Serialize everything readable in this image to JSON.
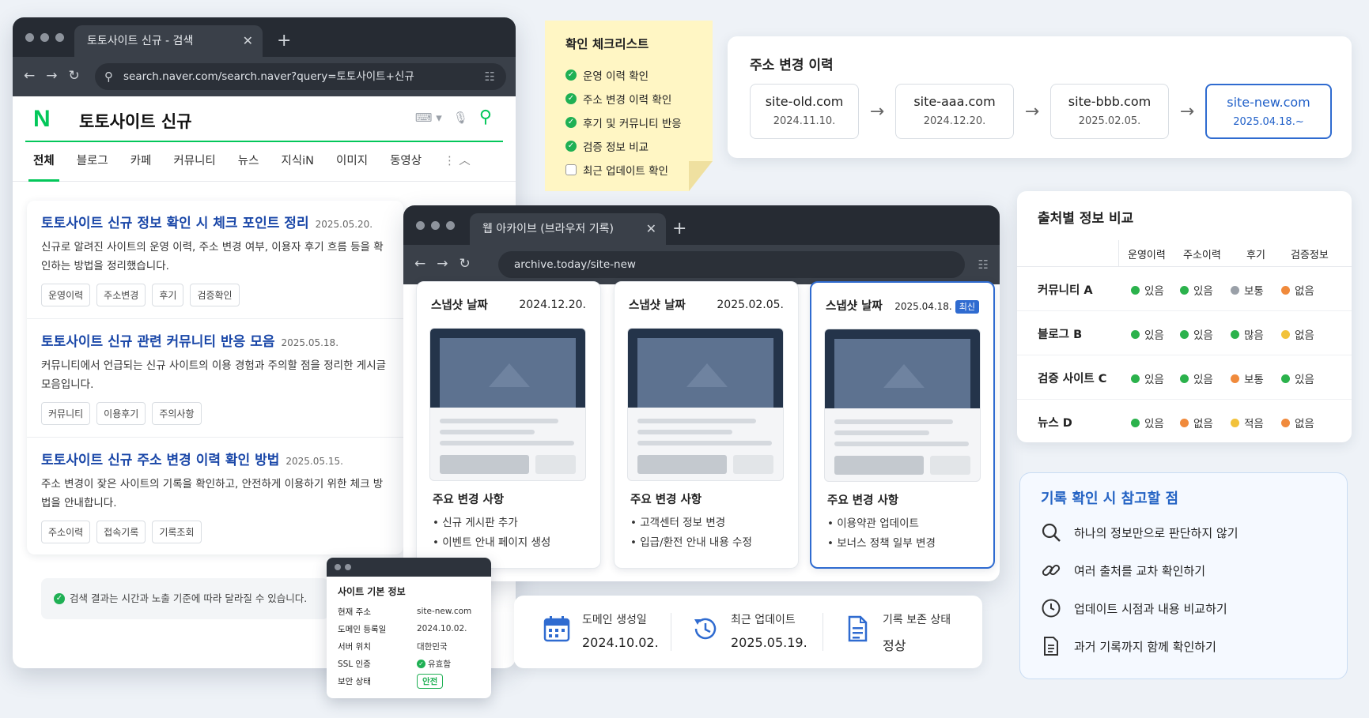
{
  "search_window": {
    "tab_title": "토토사이트 신규 - 검색",
    "url": "search.naver.com/search.naver?query=토토사이트+신규",
    "logo": "N",
    "query": "토토사이트 신규",
    "tabs": [
      "전체",
      "블로그",
      "카페",
      "커뮤니티",
      "뉴스",
      "지식iN",
      "이미지",
      "동영상"
    ],
    "results": [
      {
        "title": "토토사이트 신규 정보 확인 시 체크 포인트 정리",
        "date": "2025.05.20.",
        "desc": "신규로 알려진 사이트의 운영 이력, 주소 변경 여부, 이용자 후기 흐름 등을 확인하는 방법을 정리했습니다.",
        "tags": [
          "운영이력",
          "주소변경",
          "후기",
          "검증확인"
        ]
      },
      {
        "title": "토토사이트 신규 관련 커뮤니티 반응 모음",
        "date": "2025.05.18.",
        "desc": "커뮤니티에서 언급되는 신규 사이트의 이용 경험과 주의할 점을 정리한 게시글 모음입니다.",
        "tags": [
          "커뮤니티",
          "이용후기",
          "주의사항"
        ]
      },
      {
        "title": "토토사이트 신규 주소 변경 이력 확인 방법",
        "date": "2025.05.15.",
        "desc": "주소 변경이 잦은 사이트의 기록을 확인하고, 안전하게 이용하기 위한 체크 방법을 안내합니다.",
        "tags": [
          "주소이력",
          "접속기록",
          "기록조회"
        ]
      }
    ],
    "notice": "검색 결과는 시간과 노출 기준에 따라 달라질 수 있습니다."
  },
  "checklist": {
    "title": "확인 체크리스트",
    "items": [
      {
        "label": "운영 이력 확인",
        "checked": true
      },
      {
        "label": "주소 변경 이력 확인",
        "checked": true
      },
      {
        "label": "후기 및 커뮤니티 반응",
        "checked": true
      },
      {
        "label": "검증 정보 비교",
        "checked": true
      },
      {
        "label": "최근 업데이트 확인",
        "checked": false
      }
    ]
  },
  "address_history": {
    "title": "주소 변경 이력",
    "entries": [
      {
        "domain": "site-old.com",
        "date": "2024.11.10."
      },
      {
        "domain": "site-aaa.com",
        "date": "2024.12.20."
      },
      {
        "domain": "site-bbb.com",
        "date": "2025.02.05."
      },
      {
        "domain": "site-new.com",
        "date": "2025.04.18.~"
      }
    ]
  },
  "archive_window": {
    "tab_title": "웹 아카이브 (브라우저 기록)",
    "url": "archive.today/site-new",
    "snapshot_label": "스냅샷 날짜",
    "changes_label": "주요 변경 사항",
    "latest_badge": "최신",
    "snapshots": [
      {
        "date": "2024.12.20.",
        "changes": [
          "• 신규 게시판 추가",
          "• 이벤트 안내 페이지 생성"
        ]
      },
      {
        "date": "2025.02.05.",
        "changes": [
          "• 고객센터 정보 변경",
          "• 입급/환전 안내 내용 수정"
        ]
      },
      {
        "date": "2025.04.18.",
        "changes": [
          "• 이용약관 업데이트",
          "• 보너스 정책 일부 변경"
        ]
      }
    ]
  },
  "site_info": {
    "title": "사이트 기본 정보",
    "rows": [
      {
        "key": "현재 주소",
        "value": "site-new.com"
      },
      {
        "key": "도메인 등록일",
        "value": "2024.10.02."
      },
      {
        "key": "서버 위치",
        "value": "대한민국"
      },
      {
        "key": "SSL 인증",
        "value": "유효함"
      },
      {
        "key": "보안 상태",
        "value": "안전"
      }
    ]
  },
  "stats": [
    {
      "label": "도메인 생성일",
      "value": "2024.10.02.",
      "icon": "calendar-icon"
    },
    {
      "label": "최근 업데이트",
      "value": "2025.05.19.",
      "icon": "history-icon"
    },
    {
      "label": "기록 보존 상태",
      "value": "정상",
      "icon": "document-icon"
    }
  ],
  "comparison": {
    "title": "출처별 정보 비교",
    "columns": [
      "운영이력",
      "주소이력",
      "후기",
      "검증정보"
    ],
    "status_colors": {
      "good": "#2bb24c",
      "neutral": "#9aa0a8",
      "warn": "#f08a3c",
      "caution": "#f2c23a"
    },
    "rows": [
      {
        "source": "커뮤니티 A",
        "cells": [
          {
            "text": "있음",
            "color": "#2bb24c"
          },
          {
            "text": "있음",
            "color": "#2bb24c"
          },
          {
            "text": "보통",
            "color": "#9aa0a8"
          },
          {
            "text": "없음",
            "color": "#f08a3c"
          }
        ]
      },
      {
        "source": "블로그 B",
        "cells": [
          {
            "text": "있음",
            "color": "#2bb24c"
          },
          {
            "text": "있음",
            "color": "#2bb24c"
          },
          {
            "text": "많음",
            "color": "#2bb24c"
          },
          {
            "text": "없음",
            "color": "#f2c23a"
          }
        ]
      },
      {
        "source": "검증 사이트 C",
        "cells": [
          {
            "text": "있음",
            "color": "#2bb24c"
          },
          {
            "text": "있음",
            "color": "#2bb24c"
          },
          {
            "text": "보통",
            "color": "#f08a3c"
          },
          {
            "text": "있음",
            "color": "#2bb24c"
          }
        ]
      },
      {
        "source": "뉴스 D",
        "cells": [
          {
            "text": "있음",
            "color": "#2bb24c"
          },
          {
            "text": "없음",
            "color": "#f08a3c"
          },
          {
            "text": "적음",
            "color": "#f2c23a"
          },
          {
            "text": "없음",
            "color": "#f08a3c"
          }
        ]
      }
    ]
  },
  "tips": {
    "title": "기록 확인 시 참고할 점",
    "items": [
      {
        "text": "하나의 정보만으로 판단하지 않기",
        "icon": "search-icon"
      },
      {
        "text": "여러 출처를 교차 확인하기",
        "icon": "link-icon"
      },
      {
        "text": "업데이트 시점과 내용 비교하기",
        "icon": "clock-icon"
      },
      {
        "text": "과거 기록까지 함께 확인하기",
        "icon": "document-icon"
      }
    ]
  }
}
